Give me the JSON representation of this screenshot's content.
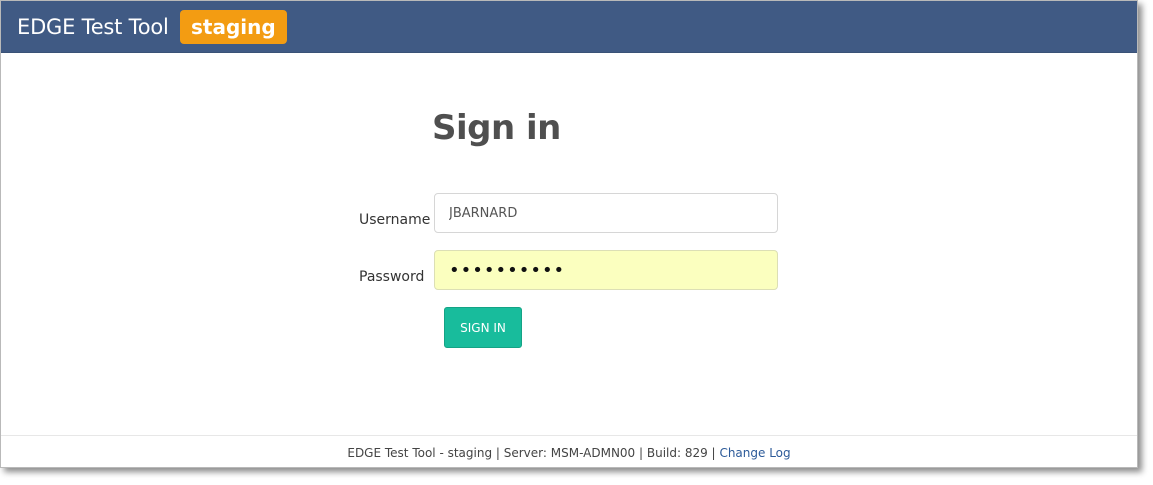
{
  "navbar": {
    "brand": "EDGE Test Tool",
    "environment_badge": "staging",
    "background_color": "#405a84",
    "badge_color": "#f39c12"
  },
  "signin": {
    "title": "Sign in",
    "username_label": "Username",
    "username_value": "JBARNARD",
    "password_label": "Password",
    "password_value": "••••••••••",
    "button_label": "SIGN IN",
    "button_color": "#18bc9c"
  },
  "footer": {
    "text": "EDGE Test Tool - staging | Server: MSM-ADMN00 | Build: 829 |",
    "link_label": "Change Log"
  }
}
